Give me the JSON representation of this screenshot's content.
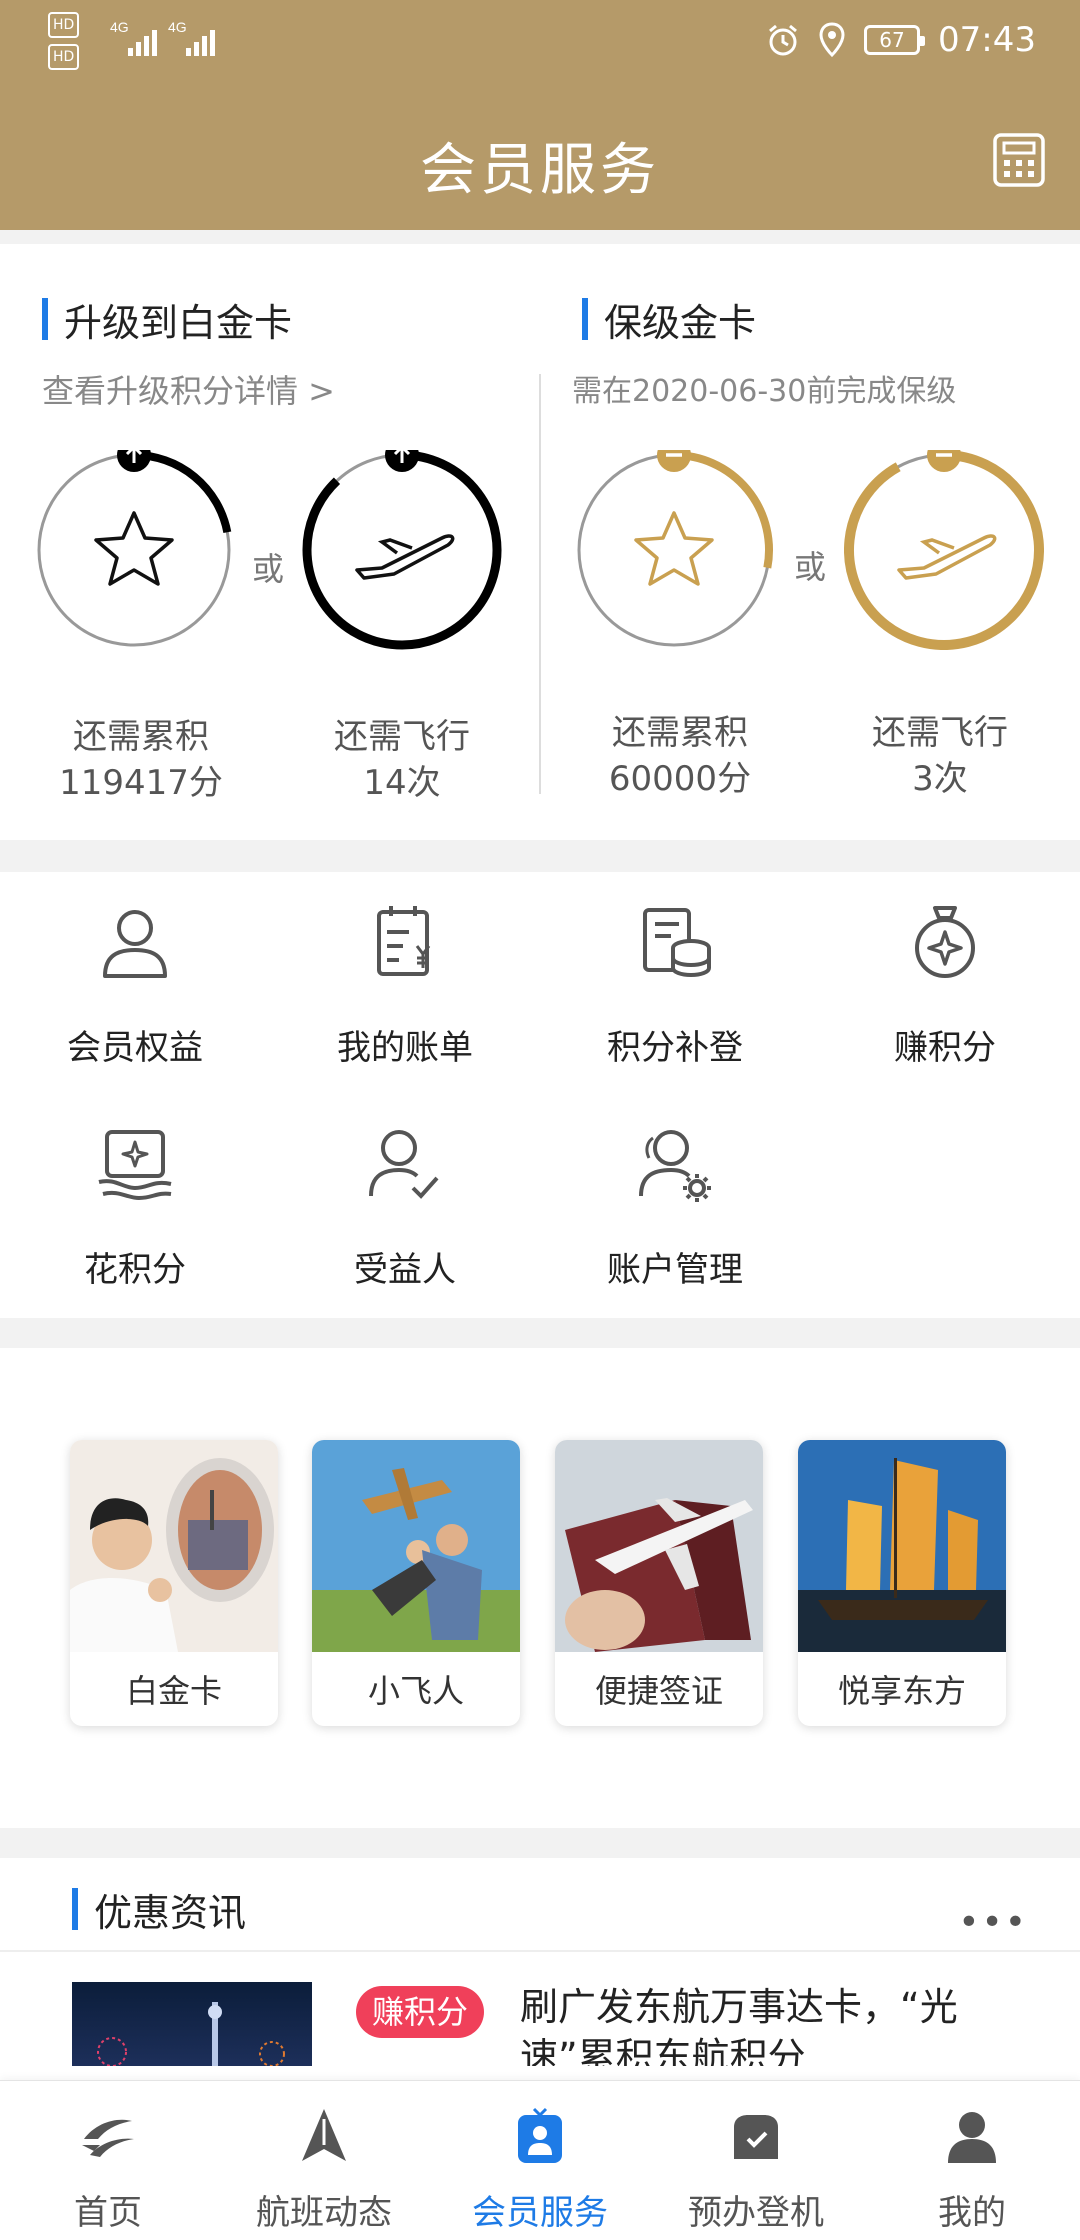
{
  "status_bar": {
    "left_badges": [
      "HD",
      "HD"
    ],
    "network": [
      "4G",
      "4G"
    ],
    "battery": "67",
    "time": "07:43"
  },
  "header": {
    "title": "会员服务",
    "calculator_icon": "calculator-icon"
  },
  "upgrade": {
    "title": "升级到白金卡",
    "subtitle": "查看升级积分详情 >",
    "or": "或",
    "points_label": "还需累积",
    "points_value": "119417分",
    "flights_label": "还需飞行",
    "flights_value": "14次",
    "points_progress": 0.22,
    "flights_progress": 0.88,
    "color": "#000000"
  },
  "keep": {
    "title": "保级金卡",
    "subtitle": "需在2020-06-30前完成保级",
    "or": "或",
    "points_label": "还需累积",
    "points_value": "60000分",
    "flights_label": "还需飞行",
    "flights_value": "3次",
    "points_progress": 0.28,
    "flights_progress": 0.92,
    "color": "#c9a050"
  },
  "grid": [
    {
      "label": "会员权益",
      "icon": "user-icon"
    },
    {
      "label": "我的账单",
      "icon": "bill-icon"
    },
    {
      "label": "积分补登",
      "icon": "points-stack-icon"
    },
    {
      "label": "赚积分",
      "icon": "medal-icon"
    },
    {
      "label": "花积分",
      "icon": "spend-points-icon"
    },
    {
      "label": "受益人",
      "icon": "beneficiary-icon"
    },
    {
      "label": "账户管理",
      "icon": "account-settings-icon"
    }
  ],
  "tiles": [
    {
      "label": "白金卡"
    },
    {
      "label": "小飞人"
    },
    {
      "label": "便捷签证"
    },
    {
      "label": "悦享东方"
    }
  ],
  "news": {
    "title": "优惠资讯",
    "more": "•••",
    "badge": "赚积分",
    "headline": "刷广发东航万事达卡，“光速”累积东航积分"
  },
  "nav": [
    {
      "label": "首页",
      "icon": "eastern-logo-icon"
    },
    {
      "label": "航班动态",
      "icon": "flight-status-icon"
    },
    {
      "label": "会员服务",
      "icon": "member-icon"
    },
    {
      "label": "预办登机",
      "icon": "checkin-icon"
    },
    {
      "label": "我的",
      "icon": "profile-icon"
    }
  ],
  "colors": {
    "brand": "#b59a69",
    "accent": "#1e7be6",
    "badge": "#f0405a"
  }
}
